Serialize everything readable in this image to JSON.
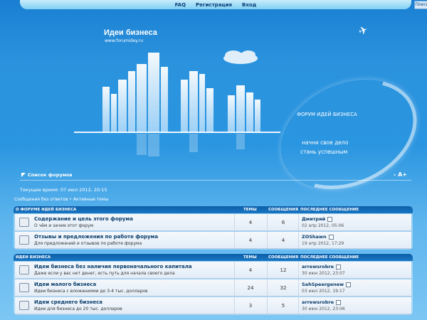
{
  "header": {
    "nav": [
      "FAQ",
      "Регистрация",
      "Вход"
    ],
    "corner_button": "Поиск",
    "site_title": "Идеи бизнеса",
    "site_url": "www.forumidey.ru",
    "banner_title": "ФОРУМ ИДЕЙ БИЗНЕСА",
    "slogan_line1": "начни свое дело",
    "slogan_line2": "стань успешным"
  },
  "nav": {
    "home_label": "Список форумов",
    "font_size": "- A+"
  },
  "time_text": "Текущее время: 07 июл 2012, 20:15",
  "links": {
    "unanswered": "Сообщения без ответов",
    "active": "Активные темы"
  },
  "categories": [
    {
      "title": "О ФОРУМЕ ИДЕЙ БИЗНЕСА",
      "col_topics": "ТЕМЫ",
      "col_posts": "СООБЩЕНИЯ",
      "col_last": "ПОСЛЕДНЕЕ СООБЩЕНИЕ",
      "forums": [
        {
          "title": "Содержание и цель этого форума",
          "desc": "О чём и зачем этот форум",
          "topics": "4",
          "posts": "6",
          "last_user": "Дмитрий",
          "last_date": "02 апр 2012, 05:06"
        },
        {
          "title": "Отзывы и предложения по работе форума",
          "desc": "Для предложений и отзывов по работе форума",
          "topics": "4",
          "posts": "4",
          "last_user": "ZOShawn",
          "last_date": "19 апр 2012, 17:29"
        }
      ]
    },
    {
      "title": "ИДЕИ БИЗНЕСА",
      "col_topics": "ТЕМЫ",
      "col_posts": "СООБЩЕНИЯ",
      "col_last": "ПОСЛЕДНЕЕ СООБЩЕНИЕ",
      "forums": [
        {
          "title": "Идеи бизнеса без наличия первоначального капитала",
          "desc": "Даже если у вас нет денег, есть путь для начала своего дела",
          "topics": "4",
          "posts": "12",
          "last_user": "arrewsrobre",
          "last_date": "30 июн 2012, 23:07"
        },
        {
          "title": "Идеи малого бизнеса",
          "desc": "Идеи бизнеса с вложениями до 3-4 тыс. долларов",
          "topics": "24",
          "posts": "32",
          "last_user": "SahSpeergenew",
          "last_date": "03 июл 2012, 19:17"
        },
        {
          "title": "Идеи среднего бизнеса",
          "desc": "Идеи для бизнеса до 20 тыс. долларов",
          "topics": "3",
          "posts": "5",
          "last_user": "arrewsrobre",
          "last_date": "30 июн 2012, 23:06"
        }
      ]
    }
  ],
  "colors": {
    "accent": "#1a76c2",
    "background": "#2a95e0",
    "link": "#0b3d6b"
  }
}
